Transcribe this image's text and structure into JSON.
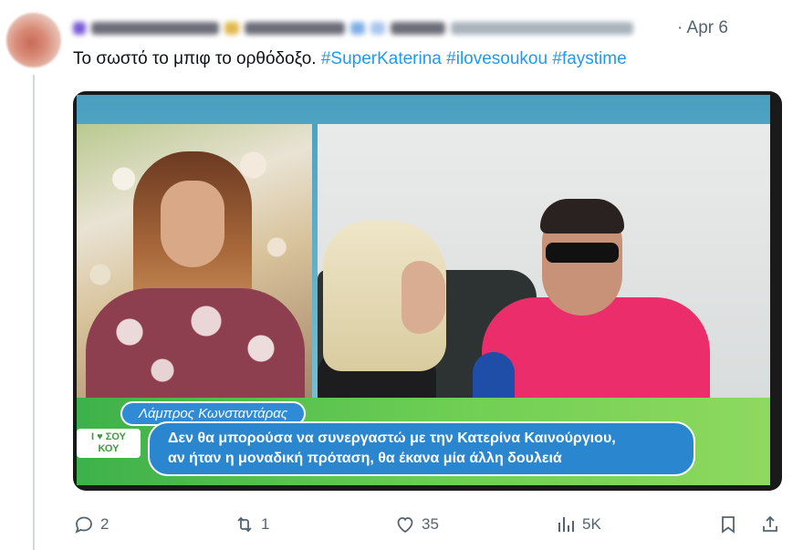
{
  "post": {
    "date": "· Apr 6",
    "text_plain": "Το σωστό το μπιφ το ορθόδοξο. ",
    "hashtags": [
      "#SuperKaterina",
      "#ilovesoukou",
      "#faystime"
    ]
  },
  "media": {
    "name_tag": "Λάμπρος Κωνσταντάρας",
    "caption_line1": "Δεν θα μπορούσα να συνεργαστώ με την Κατερίνα Καινούργιου,",
    "caption_line2": "αν ήταν η μοναδική πρόταση, θα έκανα μία άλλη δουλειά",
    "logo_line1": "I ♥ ΣΟΥ",
    "logo_line2": "ΚΟΥ"
  },
  "actions": {
    "replies": "2",
    "reposts": "1",
    "likes": "35",
    "views": "5K"
  },
  "icons": {
    "reply": "reply-icon",
    "repost": "repost-icon",
    "like": "heart-icon",
    "views": "views-icon",
    "bookmark": "bookmark-icon",
    "share": "share-icon",
    "more": "more-icon"
  },
  "colors": {
    "link": "#1d9bf0",
    "muted": "#536471",
    "text": "#0f1419"
  }
}
